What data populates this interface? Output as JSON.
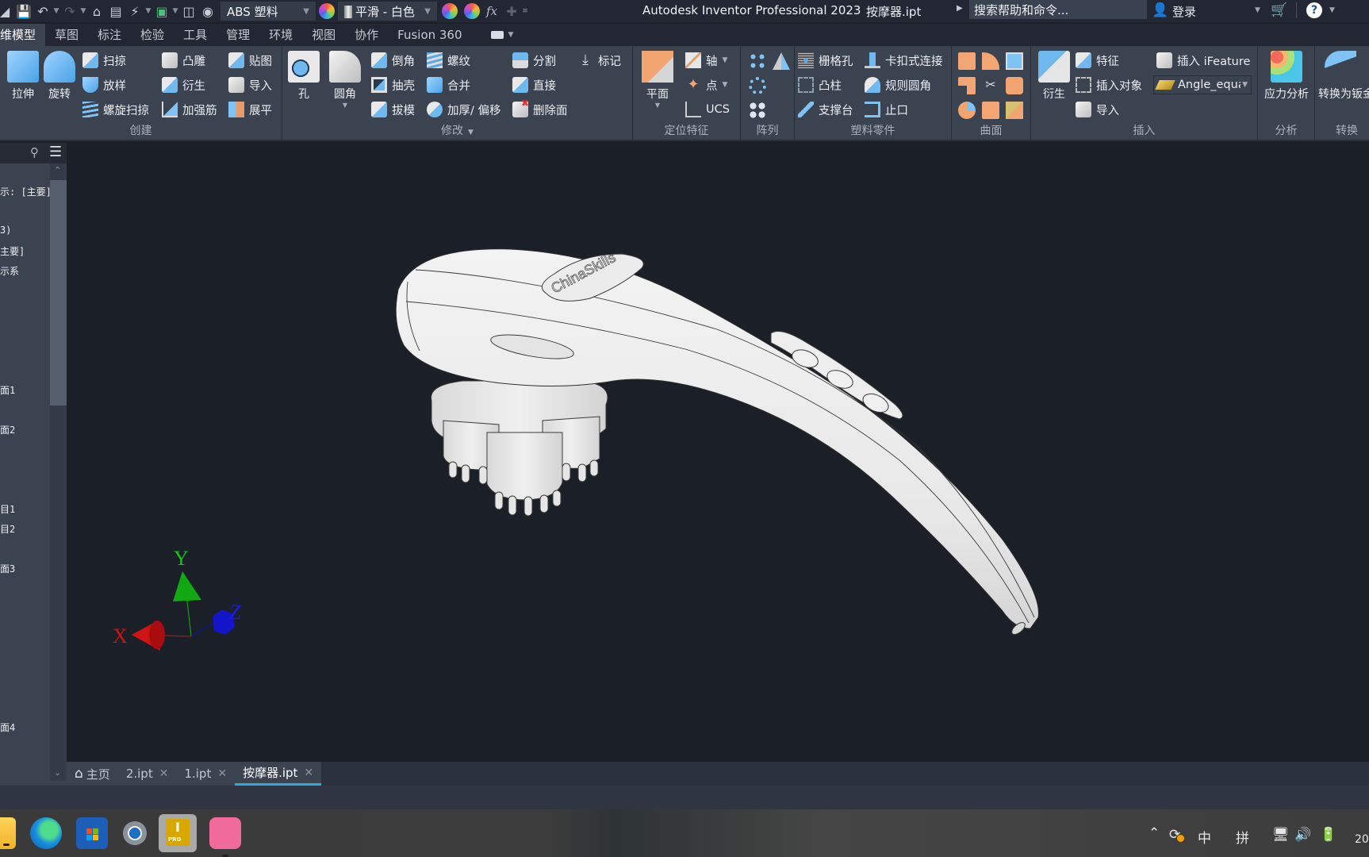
{
  "titlebar": {
    "material_select": "ABS 塑料",
    "appearance_select": "平滑 - 白色",
    "fx_label": "fx",
    "app_title": "Autodesk Inventor Professional 2023",
    "document_name": "按摩器.ipt",
    "search_placeholder": "搜索帮助和命令...",
    "signin_label": "登录"
  },
  "ribbon_tabs": [
    {
      "label": "三维模型",
      "visible_label": "维模型",
      "active": true
    },
    {
      "label": "草图"
    },
    {
      "label": "标注"
    },
    {
      "label": "检验"
    },
    {
      "label": "工具"
    },
    {
      "label": "管理"
    },
    {
      "label": "环境"
    },
    {
      "label": "视图"
    },
    {
      "label": "协作"
    },
    {
      "label": "Fusion 360"
    }
  ],
  "ribbon": {
    "create": {
      "label": "创建",
      "extrude": "拉伸",
      "revolve": "旋转",
      "sweep": "扫掠",
      "loft": "放样",
      "coil": "螺旋扫掠",
      "emboss": "凸雕",
      "derive": "衍生",
      "rib": "加强筋",
      "decal": "贴图",
      "import": "导入",
      "unfold": "展平"
    },
    "modify": {
      "label": "修改",
      "hole": "孔",
      "fillet": "圆角",
      "chamfer": "倒角",
      "shell": "抽壳",
      "draft": "拔模",
      "thread": "螺纹",
      "combine": "合并",
      "thicken": "加厚/ 偏移",
      "split": "分割",
      "direct": "直接",
      "delete_face": "删除面",
      "mark": "标记"
    },
    "work_features": {
      "label": "定位特征",
      "plane": "平面",
      "axis": "轴",
      "point": "点",
      "ucs": "UCS"
    },
    "pattern": {
      "label": "阵列"
    },
    "plastic_part": {
      "label": "塑料零件",
      "grill": "栅格孔",
      "boss": "凸柱",
      "rest": "支撑台",
      "snap_fit": "卡扣式连接",
      "rule_fillet": "规则圆角",
      "lip": "止口"
    },
    "surface": {
      "label": "曲面"
    },
    "insert": {
      "label": "插入",
      "derive": "衍生",
      "feature": "特征",
      "insert_object": "插入对象",
      "import": "导入",
      "insert_ifeature": "插入 iFeature",
      "ifeature_select": "Angle_equa"
    },
    "analysis": {
      "label": "分析",
      "stress": "应力分析"
    },
    "convert": {
      "label": "转换",
      "to_sheet_metal": "转换为钣金"
    }
  },
  "browser": {
    "items": [
      "示: [主要]",
      "3)",
      "主要]",
      "示系",
      "面1",
      "面2",
      "目1",
      "目2",
      "面3",
      "面4"
    ]
  },
  "viewport": {
    "logo_text": "ChinaSkills",
    "axes": {
      "x": "X",
      "y": "Y",
      "z": "Z"
    },
    "colors": {
      "x": "#d01414",
      "y": "#12a812",
      "z": "#1414d0",
      "background": "#1b1f27"
    }
  },
  "doc_tabs": [
    {
      "label": "主页",
      "icon": "home-icon"
    },
    {
      "label": "2.ipt",
      "closable": true
    },
    {
      "label": "1.ipt",
      "closable": true
    },
    {
      "label": "按摩器.ipt",
      "closable": true,
      "active": true
    }
  ],
  "taskbar": {
    "apps": [
      "file-explorer",
      "edge",
      "microsoft-store",
      "settings",
      "inventor-pro",
      "bilibili"
    ],
    "inventor_badge": "PRO",
    "tray": {
      "ime_mode": "中",
      "ime_input": "拼",
      "clock_partial": "20"
    }
  },
  "accent": "#2fa7d8"
}
